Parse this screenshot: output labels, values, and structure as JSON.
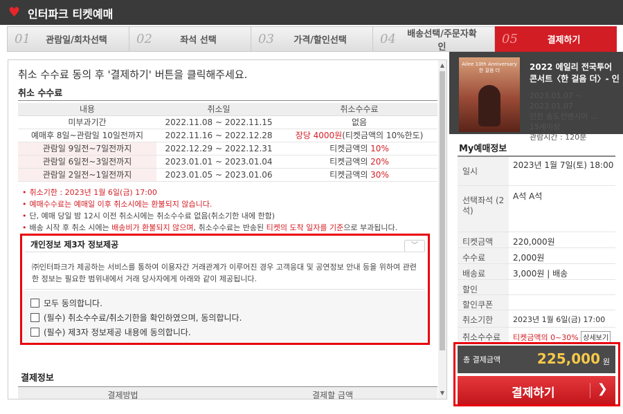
{
  "app": {
    "title": "인터파크 티켓예매"
  },
  "steps": [
    {
      "num": "01",
      "label": "관람일/회차선택",
      "active": false
    },
    {
      "num": "02",
      "label": "좌석 선택",
      "active": false
    },
    {
      "num": "03",
      "label": "가격/할인선택",
      "active": false
    },
    {
      "num": "04",
      "label": "배송선택/주문자확인",
      "active": false
    },
    {
      "num": "05",
      "label": "결제하기",
      "active": true
    }
  ],
  "main": {
    "instruction": "취소 수수료 동의 후 '결제하기' 버튼을 클릭해주세요.",
    "cancel_fee": {
      "title": "취소 수수료",
      "headers": [
        "내용",
        "취소일",
        "취소수수료"
      ],
      "rows": [
        {
          "content": "미부과기간",
          "date": "2022.11.08 ~ 2022.11.15",
          "fee": "없음"
        },
        {
          "content": "예매후 8일~관람일 10일전까지",
          "date": "2022.11.16 ~ 2022.12.28",
          "fee_red": "장당 4000원",
          "fee": "(티켓금액의 10%한도)"
        },
        {
          "content": "관람일 9일전~7일전까지",
          "date": "2022.12.29 ~ 2022.12.31",
          "fee": "티켓금액의 ",
          "fee_red": "10%"
        },
        {
          "content": "관람일 6일전~3일전까지",
          "date": "2023.01.01 ~ 2023.01.04",
          "fee": "티켓금액의 ",
          "fee_red": "20%"
        },
        {
          "content": "관람일 2일전~1일전까지",
          "date": "2023.01.05 ~ 2023.01.06",
          "fee": "티켓금액의 ",
          "fee_red": "30%"
        }
      ],
      "notes": [
        "취소기한 : 2023년 1월 6일(금) 17:00",
        "예매수수료는 예매일 이후 취소시에는 환불되지 않습니다.",
        "단, 예매 당일 밤 12시 이전 취소시에는 취소수수료 없음(취소기한 내에 한함)"
      ],
      "note4": {
        "a": "배송 시작 후 취소 시에는 ",
        "b": "배송비가 환불되지 않으며",
        "c": ", 취소수수료는 반송된 ",
        "d": "티켓의 도착 일자를 기준",
        "e": "으로 부과됩니다."
      }
    },
    "privacy": {
      "title": "개인정보 제3자 정보제공",
      "body": "㈜인터파크가 제공하는 서비스를 통하여 이용자간 거래관계가 이루어진 경우 고객응대 및 공연정보 안내 등을 위하여 관련한 정보는 필요한 범위내에서 거래 당사자에게 아래와 같이 제공됩니다.",
      "checks": [
        "모두 동의합니다.",
        "(필수) 취소수수료/취소기한을 확인하였으며, 동의합니다.",
        "(필수) 제3자 정보제공 내용에 동의합니다."
      ]
    },
    "payment": {
      "title": "결제정보",
      "headers": [
        "결제방법",
        "결제할 금액"
      ]
    }
  },
  "sidebar": {
    "poster_text": "Ailee 10th Anniversary 한 걸음 더",
    "show_title": "2022 에일리 전국투어 콘서트〈한 걸음 더〉- 인",
    "show_info": [
      "2023.01.07 ~",
      "2023.01.07",
      "인천 송도컨벤시아 ...",
      "15세이상",
      "관람시간 : 120분"
    ],
    "my_title": "My예매정보",
    "info": [
      {
        "k": "일시",
        "v": "2023년 1월 7일(토) 18:00"
      },
      {
        "k": "선택좌석 (2석)",
        "v": "A석 A석"
      },
      {
        "k": "티켓금액",
        "v": "220,000원"
      },
      {
        "k": "수수료",
        "v": "2,000원"
      },
      {
        "k": "배송료",
        "v": "3,000원 | 배송"
      },
      {
        "k": "할인",
        "v": ""
      },
      {
        "k": "할인쿠폰",
        "v": ""
      },
      {
        "k": "취소기한",
        "v": "2023년 1월 6일(금) 17:00"
      },
      {
        "k": "취소수수료",
        "v": "티켓금액의 0~30%"
      }
    ],
    "detail_btn": "상세보기",
    "total_label": "총 결제금액",
    "total_amount": "225,000",
    "total_unit": "원",
    "pay_button": "결제하기",
    "pay_arrow": "❯"
  },
  "colors": {
    "accent": "#d31d24",
    "highlight_box": "#e8000d",
    "total_amount": "#f7c948"
  }
}
